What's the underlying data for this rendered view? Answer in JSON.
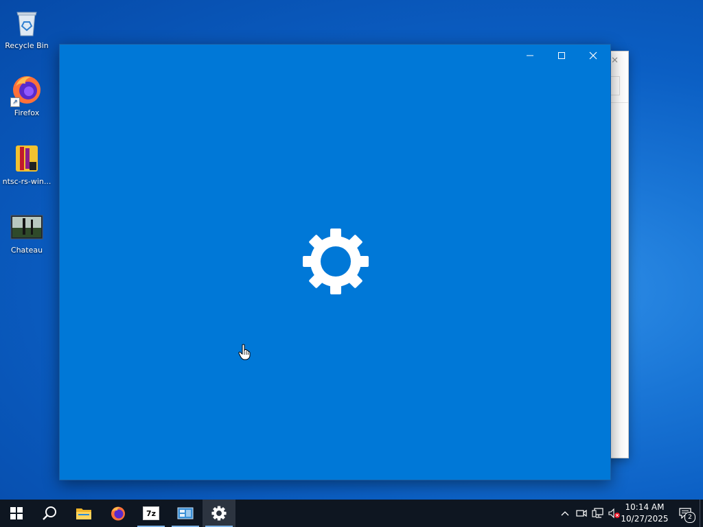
{
  "desktop": {
    "icons": [
      {
        "label": "Recycle Bin",
        "icon": "recycle-bin-icon"
      },
      {
        "label": "Firefox",
        "icon": "firefox-icon"
      },
      {
        "label": "ntsc-rs-win...",
        "icon": "ntsc-rs-icon"
      },
      {
        "label": "Chateau",
        "icon": "image-file-icon"
      }
    ]
  },
  "settings_window": {
    "splash_icon": "gear-icon",
    "background_color": "#0078d7",
    "controls": {
      "minimize": "minimize-icon",
      "maximize": "maximize-icon",
      "close": "close-icon"
    }
  },
  "taskbar": {
    "start": "windows-start-icon",
    "search": "search-icon",
    "pinned": [
      {
        "app": "File Explorer",
        "icon": "folder-icon"
      },
      {
        "app": "Firefox",
        "icon": "firefox-icon"
      },
      {
        "app": "7-Zip",
        "icon": "7zip-icon",
        "label": "7z"
      },
      {
        "app": "Control Panel",
        "icon": "control-panel-icon"
      },
      {
        "app": "Settings",
        "icon": "gear-icon",
        "active": true
      }
    ],
    "tray": {
      "show_hidden": "chevron-up-icon",
      "meet": "camera-icon",
      "network": "network-icon",
      "volume": "volume-muted-icon"
    },
    "clock": {
      "time": "10:14 AM",
      "date": "10/27/2025"
    },
    "notifications": {
      "count": "2"
    }
  }
}
